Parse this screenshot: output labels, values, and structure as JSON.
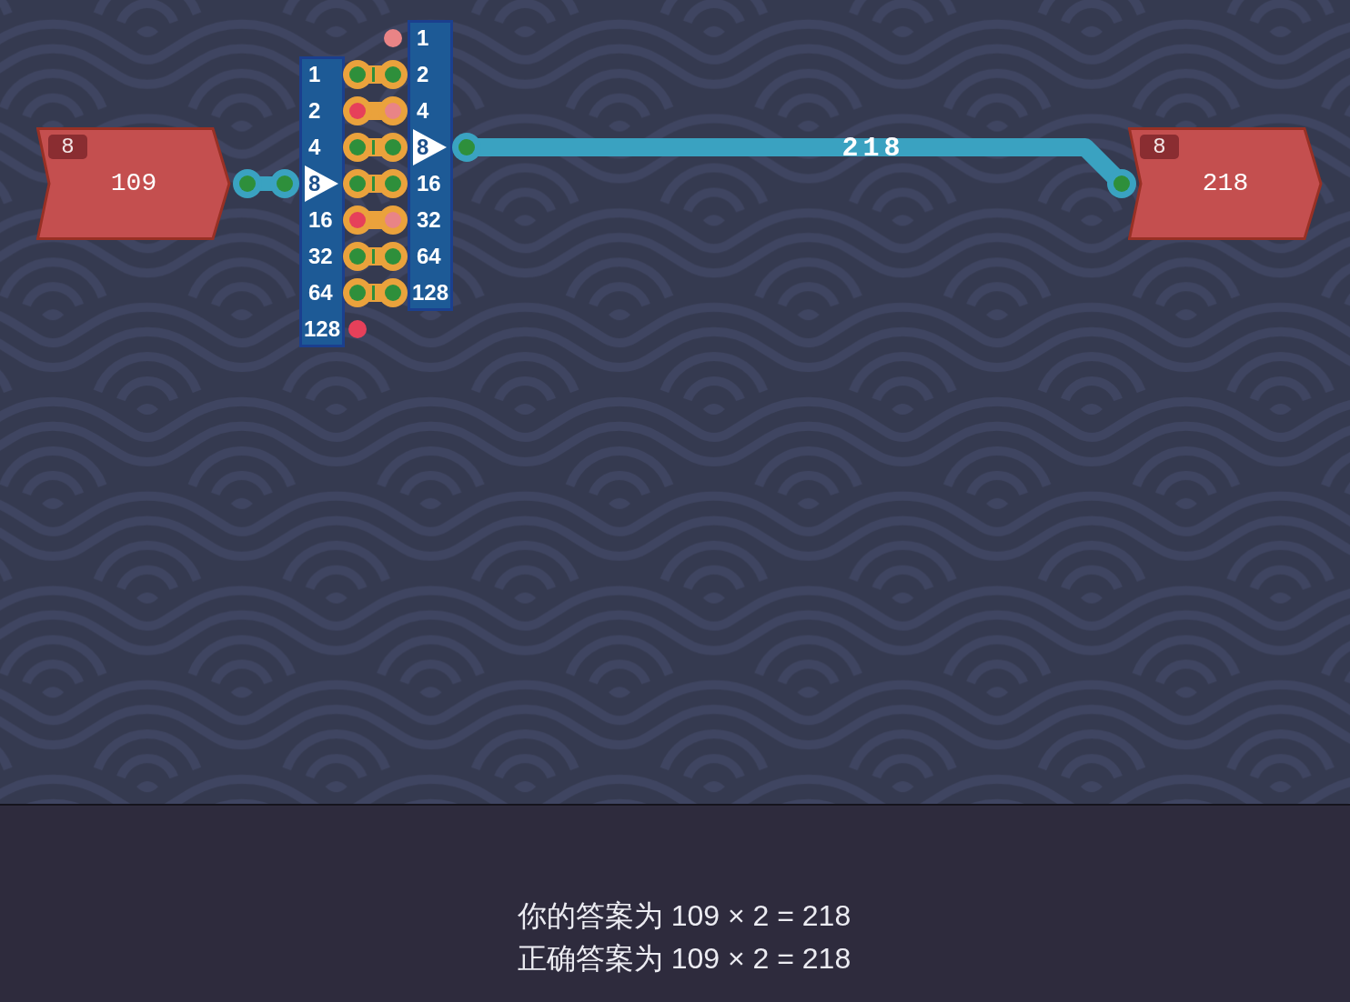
{
  "input_node": {
    "badge": "8",
    "value": "109",
    "output_on": true
  },
  "splitter": {
    "input_on": true,
    "rows": [
      {
        "label": "1",
        "port": false,
        "on": true,
        "linked": true
      },
      {
        "label": "2",
        "port": false,
        "on": false,
        "linked": true
      },
      {
        "label": "4",
        "port": false,
        "on": true,
        "linked": true
      },
      {
        "label": "8",
        "port": true,
        "on": true,
        "linked": true
      },
      {
        "label": "16",
        "port": false,
        "on": false,
        "linked": true
      },
      {
        "label": "32",
        "port": false,
        "on": true,
        "linked": true
      },
      {
        "label": "64",
        "port": false,
        "on": true,
        "linked": true
      },
      {
        "label": "128",
        "port": false,
        "on": false,
        "linked": false
      }
    ]
  },
  "maker": {
    "output_on": true,
    "rows": [
      {
        "label": "1",
        "port": false,
        "on": false
      },
      {
        "label": "2",
        "port": false,
        "on": true
      },
      {
        "label": "4",
        "port": false,
        "on": false
      },
      {
        "label": "8",
        "port": true,
        "on": true
      },
      {
        "label": "16",
        "port": false,
        "on": true
      },
      {
        "label": "32",
        "port": false,
        "on": false
      },
      {
        "label": "64",
        "port": false,
        "on": true
      },
      {
        "label": "128",
        "port": false,
        "on": true
      }
    ]
  },
  "output_wire": {
    "label": "218"
  },
  "output_node": {
    "badge": "8",
    "value": "218",
    "input_on": true
  },
  "result": {
    "lines": [
      "你的答案为 109 × 2 = 218",
      "正确答案为 109 × 2 = 218"
    ]
  }
}
